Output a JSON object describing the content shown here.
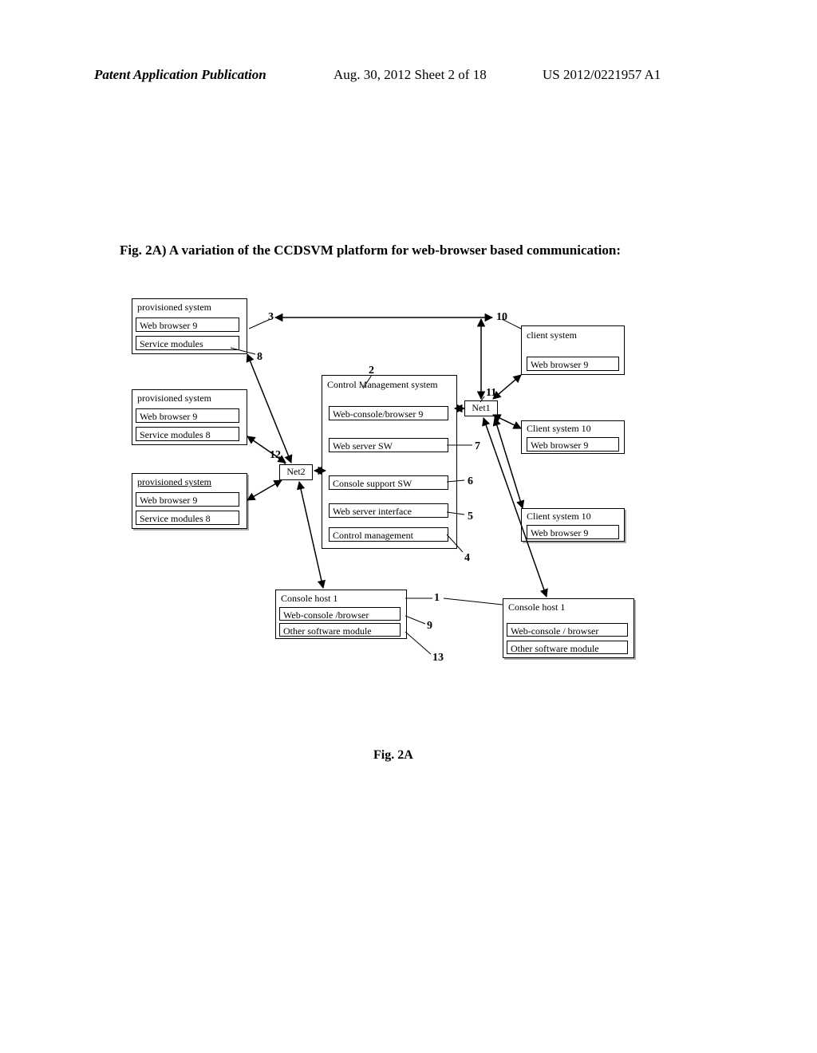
{
  "header": {
    "left": "Patent Application Publication",
    "mid": "Aug. 30, 2012  Sheet 2 of 18",
    "right": "US 2012/0221957 A1"
  },
  "fig_title": "Fig. 2A)   A variation of the CCDSVM platform for web-browser based communication:",
  "fig_caption": "Fig. 2A",
  "prov1": {
    "title": "provisioned system",
    "browser": "Web browser  9",
    "services": "Service modules"
  },
  "prov2": {
    "title": "provisioned system",
    "browser": "Web browser  9",
    "services": "Service modules 8"
  },
  "prov3": {
    "title": "provisioned system",
    "browser": "Web browser  9",
    "services": "Service modules 8"
  },
  "control": {
    "title": "Control Management system",
    "m1": "Web-console/browser 9",
    "m2": "Web server SW",
    "m3": "Console support SW",
    "m4": "Web server interface",
    "m5": "Control management"
  },
  "client1": {
    "title": "client system",
    "browser": "Web browser  9"
  },
  "client2": {
    "title": "Client system 10",
    "browser": "Web browser  9"
  },
  "client3": {
    "title": "Client system 10",
    "browser": "Web browser  9"
  },
  "console1": {
    "title": "Console host  1",
    "c1": "Web-console /browser",
    "c2": "Other software module"
  },
  "console2": {
    "title": "Console host  1",
    "c1": "Web-console / browser",
    "c2": "Other software module"
  },
  "net1": "Net1",
  "net2": "Net2",
  "labels": {
    "l1": "1",
    "l2": "2",
    "l3": "3",
    "l4": "4",
    "l5": "5",
    "l6": "6",
    "l7": "7",
    "l8": "8",
    "l9": "9",
    "l10": "10",
    "l11": "11",
    "l12": "12",
    "l13": "13"
  }
}
